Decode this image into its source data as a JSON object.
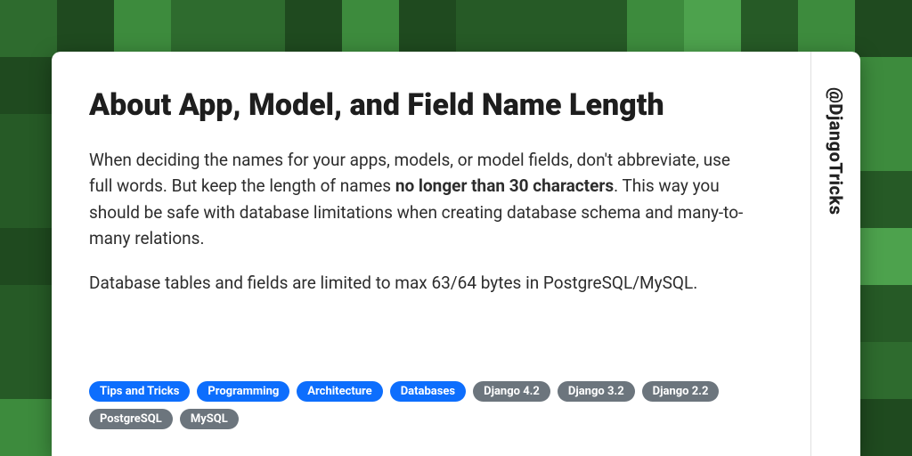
{
  "title": "About App, Model, and Field Name Length",
  "body": {
    "p1_pre": "When deciding the names for your apps, models, or model fields, don't abbreviate, use full words. But keep the length of names ",
    "p1_bold": "no longer than 30 characters",
    "p1_post": ". This way you should be safe with database limitations when creating database schema and many-to-many relations.",
    "p2": "Database tables and fields are limited to max 63/64 bytes in PostgreSQL/MySQL."
  },
  "handle": "@DjangoTricks",
  "tags": [
    {
      "label": "Tips and Tricks",
      "variant": "blue"
    },
    {
      "label": "Programming",
      "variant": "blue"
    },
    {
      "label": "Architecture",
      "variant": "blue"
    },
    {
      "label": "Databases",
      "variant": "blue"
    },
    {
      "label": "Django 4.2",
      "variant": "gray"
    },
    {
      "label": "Django 3.2",
      "variant": "gray"
    },
    {
      "label": "Django 2.2",
      "variant": "gray"
    },
    {
      "label": "PostgreSQL",
      "variant": "gray"
    },
    {
      "label": "MySQL",
      "variant": "gray"
    }
  ]
}
